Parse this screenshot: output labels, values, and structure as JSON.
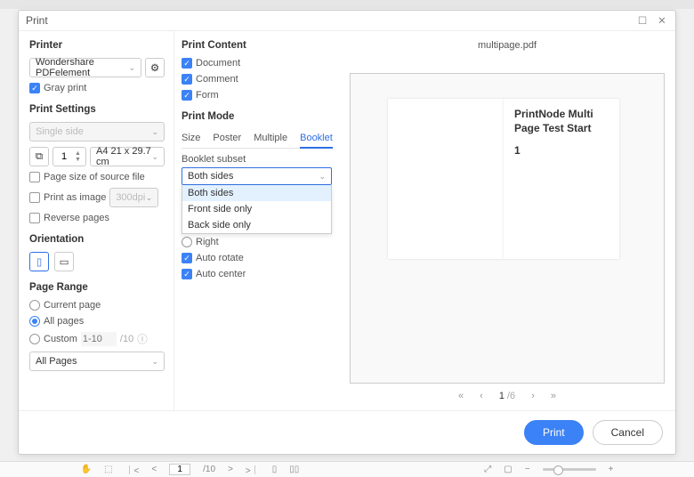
{
  "dialog": {
    "title": "Print",
    "filename": "multipage.pdf"
  },
  "left": {
    "printer_h": "Printer",
    "printerSel": "Wondershare PDFelement",
    "gray": "Gray print",
    "settings_h": "Print Settings",
    "singleside": "Single side",
    "copies": "1",
    "papersize": "A4 21 x 29.7 cm",
    "pagesrc": "Page size of source file",
    "asimg": "Print as image",
    "dpi": "300dpi",
    "reverse": "Reverse pages",
    "orient_h": "Orientation",
    "range_h": "Page Range",
    "curpage": "Current page",
    "allpages": "All pages",
    "custom": "Custom",
    "customPlaceholder": "1-10",
    "customTotal": "/10",
    "allPagesSel": "All Pages"
  },
  "mid": {
    "content_h": "Print Content",
    "doc": "Document",
    "comment": "Comment",
    "form": "Form",
    "mode_h": "Print Mode",
    "tabs": {
      "size": "Size",
      "poster": "Poster",
      "multiple": "Multiple",
      "booklet": "Booklet"
    },
    "subset_h": "Booklet subset",
    "subset_sel": "Both sides",
    "subset_opts": [
      "Both sides",
      "Front side only",
      "Back side only"
    ],
    "right": "Right",
    "autorotate": "Auto rotate",
    "autocenter": "Auto center"
  },
  "preview": {
    "title": "PrintNode Multi Page Test Start",
    "pagenum": "1"
  },
  "pager": {
    "first": "«",
    "prev": "‹",
    "cur": "1",
    "total": "/6",
    "next": "›",
    "last": "»"
  },
  "footer": {
    "print": "Print",
    "cancel": "Cancel"
  },
  "bottombar": {
    "page": "1",
    "total": "/10"
  }
}
